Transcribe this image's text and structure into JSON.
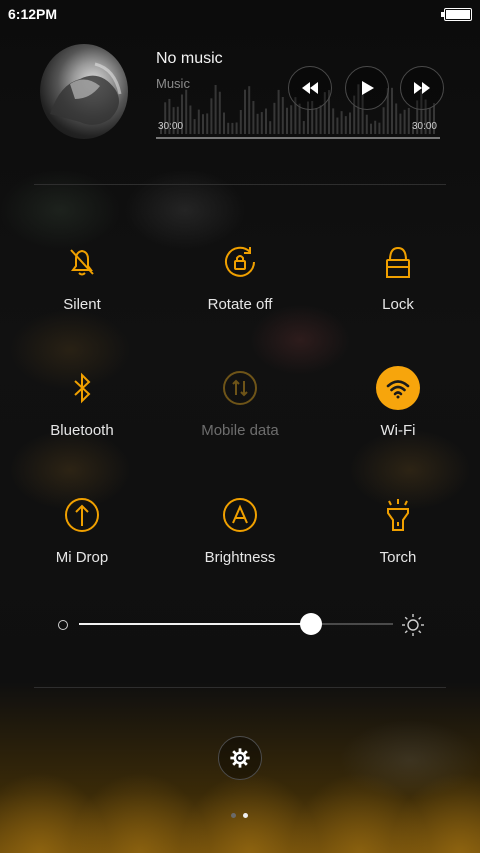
{
  "status_bar": {
    "time": "6:12PM",
    "battery_level": 1.0
  },
  "music": {
    "title": "No music",
    "subtitle": "Music",
    "elapsed": "30:00",
    "duration": "30:00",
    "controls": [
      "rewind-icon",
      "play-icon",
      "fast-forward-icon"
    ]
  },
  "toggles": [
    {
      "id": "silent",
      "label": "Silent",
      "icon": "bell-off-icon",
      "state": "off"
    },
    {
      "id": "rotate",
      "label": "Rotate off",
      "icon": "rotate-lock-icon",
      "state": "off"
    },
    {
      "id": "lock",
      "label": "Lock",
      "icon": "lock-icon",
      "state": "off"
    },
    {
      "id": "bluetooth",
      "label": "Bluetooth",
      "icon": "bluetooth-icon",
      "state": "off"
    },
    {
      "id": "mobile-data",
      "label": "Mobile data",
      "icon": "mobile-data-icon",
      "state": "disabled"
    },
    {
      "id": "wifi",
      "label": "Wi-Fi",
      "icon": "wifi-icon",
      "state": "on"
    },
    {
      "id": "mi-drop",
      "label": "Mi Drop",
      "icon": "upload-arrow-icon",
      "state": "off"
    },
    {
      "id": "brightness",
      "label": "Brightness",
      "icon": "auto-brightness-icon",
      "state": "off"
    },
    {
      "id": "torch",
      "label": "Torch",
      "icon": "flashlight-icon",
      "state": "off"
    }
  ],
  "brightness_slider": {
    "value": 0.74
  },
  "pager": {
    "pages": 2,
    "current": 2
  },
  "colors": {
    "accent": "#f7a50c",
    "background": "#0b0b0b",
    "text": "#e6e6e6"
  }
}
